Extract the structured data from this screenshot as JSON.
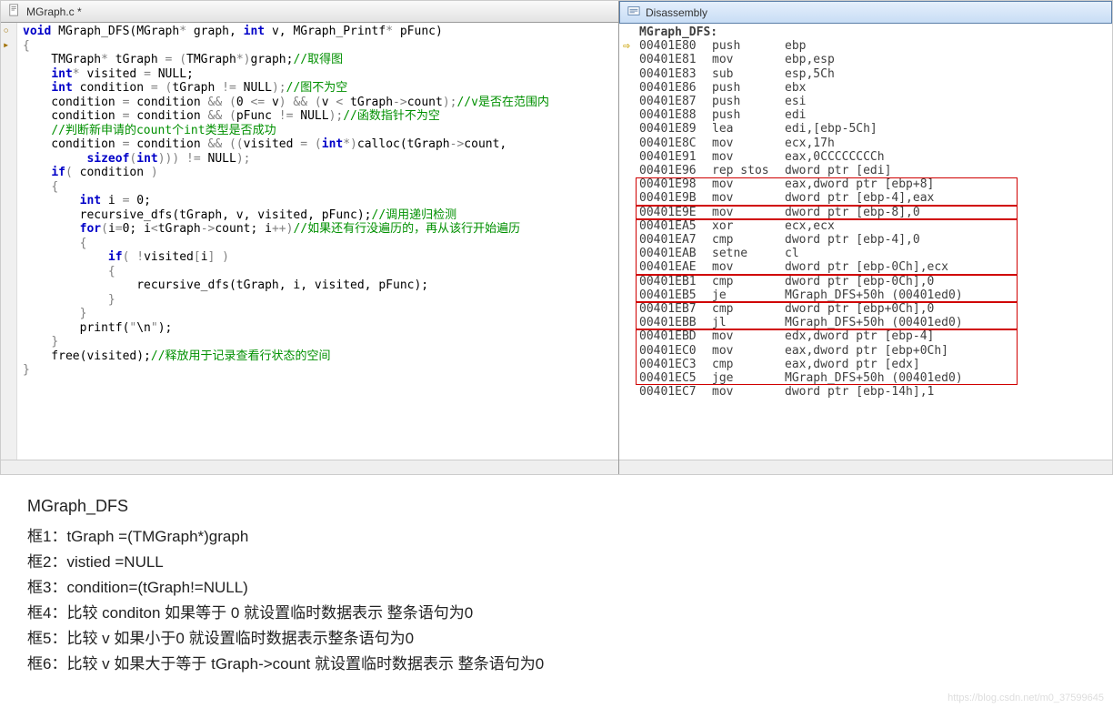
{
  "ide": {
    "code_tab": {
      "title": "MGraph.c *"
    },
    "disasm_tab": {
      "title": "Disassembly"
    },
    "code_lines": [
      [
        {
          "c": "kw",
          "t": "void"
        },
        {
          "c": "plain",
          "t": " MGraph_DFS(MGraph"
        },
        {
          "c": "sym",
          "t": "*"
        },
        {
          "c": "plain",
          "t": " graph, "
        },
        {
          "c": "kw",
          "t": "int"
        },
        {
          "c": "plain",
          "t": " v, MGraph_Printf"
        },
        {
          "c": "sym",
          "t": "*"
        },
        {
          "c": "plain",
          "t": " pFunc)"
        }
      ],
      [
        {
          "c": "sym",
          "t": "{"
        }
      ],
      [
        {
          "c": "plain",
          "t": "    TMGraph"
        },
        {
          "c": "sym",
          "t": "*"
        },
        {
          "c": "plain",
          "t": " tGraph "
        },
        {
          "c": "sym",
          "t": "= ("
        },
        {
          "c": "plain",
          "t": "TMGraph"
        },
        {
          "c": "sym",
          "t": "*)"
        },
        {
          "c": "plain",
          "t": "graph;"
        },
        {
          "c": "cm",
          "t": "//取得图"
        }
      ],
      [
        {
          "c": "plain",
          "t": "    "
        },
        {
          "c": "kw",
          "t": "int"
        },
        {
          "c": "sym",
          "t": "*"
        },
        {
          "c": "plain",
          "t": " visited "
        },
        {
          "c": "sym",
          "t": "="
        },
        {
          "c": "plain",
          "t": " NULL;"
        }
      ],
      [
        {
          "c": "plain",
          "t": "    "
        },
        {
          "c": "kw",
          "t": "int"
        },
        {
          "c": "plain",
          "t": " condition "
        },
        {
          "c": "sym",
          "t": "= ("
        },
        {
          "c": "plain",
          "t": "tGraph "
        },
        {
          "c": "sym",
          "t": "!="
        },
        {
          "c": "plain",
          "t": " NULL"
        },
        {
          "c": "sym",
          "t": ");"
        },
        {
          "c": "cm",
          "t": "//图不为空"
        }
      ],
      [
        {
          "c": "plain",
          "t": ""
        }
      ],
      [
        {
          "c": "plain",
          "t": "    condition "
        },
        {
          "c": "sym",
          "t": "="
        },
        {
          "c": "plain",
          "t": " condition "
        },
        {
          "c": "sym",
          "t": "&& ("
        },
        {
          "c": "plain",
          "t": "0 "
        },
        {
          "c": "sym",
          "t": "<="
        },
        {
          "c": "plain",
          "t": " v"
        },
        {
          "c": "sym",
          "t": ") && ("
        },
        {
          "c": "plain",
          "t": "v "
        },
        {
          "c": "sym",
          "t": "<"
        },
        {
          "c": "plain",
          "t": " tGraph"
        },
        {
          "c": "sym",
          "t": "->"
        },
        {
          "c": "plain",
          "t": "count"
        },
        {
          "c": "sym",
          "t": ");"
        },
        {
          "c": "cm",
          "t": "//v是否在范围内"
        }
      ],
      [
        {
          "c": "plain",
          "t": "    condition "
        },
        {
          "c": "sym",
          "t": "="
        },
        {
          "c": "plain",
          "t": " condition "
        },
        {
          "c": "sym",
          "t": "&& ("
        },
        {
          "c": "plain",
          "t": "pFunc "
        },
        {
          "c": "sym",
          "t": "!="
        },
        {
          "c": "plain",
          "t": " NULL"
        },
        {
          "c": "sym",
          "t": ");"
        },
        {
          "c": "cm",
          "t": "//函数指针不为空"
        }
      ],
      [
        {
          "c": "plain",
          "t": "    "
        },
        {
          "c": "cm",
          "t": "//判断新申请的count个int类型是否成功"
        }
      ],
      [
        {
          "c": "plain",
          "t": "    condition "
        },
        {
          "c": "sym",
          "t": "="
        },
        {
          "c": "plain",
          "t": " condition "
        },
        {
          "c": "sym",
          "t": "&& (("
        },
        {
          "c": "plain",
          "t": "visited "
        },
        {
          "c": "sym",
          "t": "= ("
        },
        {
          "c": "kw",
          "t": "int"
        },
        {
          "c": "sym",
          "t": "*)"
        },
        {
          "c": "plain",
          "t": "calloc(tGraph"
        },
        {
          "c": "sym",
          "t": "->"
        },
        {
          "c": "plain",
          "t": "count,"
        }
      ],
      [
        {
          "c": "plain",
          "t": "         "
        },
        {
          "c": "kw",
          "t": "sizeof"
        },
        {
          "c": "sym",
          "t": "("
        },
        {
          "c": "kw",
          "t": "int"
        },
        {
          "c": "sym",
          "t": "))) !="
        },
        {
          "c": "plain",
          "t": " NULL"
        },
        {
          "c": "sym",
          "t": ");"
        }
      ],
      [
        {
          "c": "plain",
          "t": "    "
        },
        {
          "c": "kw",
          "t": "if"
        },
        {
          "c": "sym",
          "t": "("
        },
        {
          "c": "plain",
          "t": " condition "
        },
        {
          "c": "sym",
          "t": ")"
        }
      ],
      [
        {
          "c": "plain",
          "t": "    "
        },
        {
          "c": "sym",
          "t": "{"
        }
      ],
      [
        {
          "c": "plain",
          "t": "        "
        },
        {
          "c": "kw",
          "t": "int"
        },
        {
          "c": "plain",
          "t": " i "
        },
        {
          "c": "sym",
          "t": "="
        },
        {
          "c": "plain",
          "t": " 0;"
        }
      ],
      [
        {
          "c": "plain",
          "t": "        recursive_dfs(tGraph, v, visited, pFunc);"
        },
        {
          "c": "cm",
          "t": "//调用递归检测"
        }
      ],
      [
        {
          "c": "plain",
          "t": ""
        }
      ],
      [
        {
          "c": "plain",
          "t": "        "
        },
        {
          "c": "kw",
          "t": "for"
        },
        {
          "c": "sym",
          "t": "("
        },
        {
          "c": "plain",
          "t": "i"
        },
        {
          "c": "sym",
          "t": "="
        },
        {
          "c": "plain",
          "t": "0; i"
        },
        {
          "c": "sym",
          "t": "<"
        },
        {
          "c": "plain",
          "t": "tGraph"
        },
        {
          "c": "sym",
          "t": "->"
        },
        {
          "c": "plain",
          "t": "count; i"
        },
        {
          "c": "sym",
          "t": "++)"
        },
        {
          "c": "cm",
          "t": "//如果还有行没遍历的，再从该行开始遍历"
        }
      ],
      [
        {
          "c": "plain",
          "t": "        "
        },
        {
          "c": "sym",
          "t": "{"
        }
      ],
      [
        {
          "c": "plain",
          "t": "            "
        },
        {
          "c": "kw",
          "t": "if"
        },
        {
          "c": "sym",
          "t": "( !"
        },
        {
          "c": "plain",
          "t": "visited"
        },
        {
          "c": "sym",
          "t": "["
        },
        {
          "c": "plain",
          "t": "i"
        },
        {
          "c": "sym",
          "t": "] )"
        }
      ],
      [
        {
          "c": "plain",
          "t": "            "
        },
        {
          "c": "sym",
          "t": "{"
        }
      ],
      [
        {
          "c": "plain",
          "t": ""
        }
      ],
      [
        {
          "c": "plain",
          "t": "                recursive_dfs(tGraph, i, visited, pFunc);"
        }
      ],
      [
        {
          "c": "plain",
          "t": "            "
        },
        {
          "c": "sym",
          "t": "}"
        }
      ],
      [
        {
          "c": "plain",
          "t": "        "
        },
        {
          "c": "sym",
          "t": "}"
        }
      ],
      [
        {
          "c": "plain",
          "t": "        printf("
        },
        {
          "c": "sym",
          "t": "\""
        },
        {
          "c": "plain",
          "t": "\\n"
        },
        {
          "c": "sym",
          "t": "\""
        },
        {
          "c": "plain",
          "t": ");"
        }
      ],
      [
        {
          "c": "plain",
          "t": "    "
        },
        {
          "c": "sym",
          "t": "}"
        }
      ],
      [
        {
          "c": "plain",
          "t": "    free(visited);"
        },
        {
          "c": "cm",
          "t": "//释放用于记录查看行状态的空间"
        }
      ],
      [
        {
          "c": "sym",
          "t": "}"
        }
      ]
    ],
    "disasm": {
      "label": "MGraph_DFS:",
      "arrow_index": 0,
      "lines": [
        {
          "addr": "00401E80",
          "mn": "push",
          "op": "ebp"
        },
        {
          "addr": "00401E81",
          "mn": "mov",
          "op": "ebp,esp"
        },
        {
          "addr": "00401E83",
          "mn": "sub",
          "op": "esp,5Ch"
        },
        {
          "addr": "00401E86",
          "mn": "push",
          "op": "ebx"
        },
        {
          "addr": "00401E87",
          "mn": "push",
          "op": "esi"
        },
        {
          "addr": "00401E88",
          "mn": "push",
          "op": "edi"
        },
        {
          "addr": "00401E89",
          "mn": "lea",
          "op": "edi,[ebp-5Ch]"
        },
        {
          "addr": "00401E8C",
          "mn": "mov",
          "op": "ecx,17h"
        },
        {
          "addr": "00401E91",
          "mn": "mov",
          "op": "eax,0CCCCCCCCh"
        },
        {
          "addr": "00401E96",
          "mn": "rep stos",
          "op": "dword ptr [edi]"
        },
        {
          "addr": "00401E98",
          "mn": "mov",
          "op": "eax,dword ptr [ebp+8]"
        },
        {
          "addr": "00401E9B",
          "mn": "mov",
          "op": "dword ptr [ebp-4],eax"
        },
        {
          "addr": "00401E9E",
          "mn": "mov",
          "op": "dword ptr [ebp-8],0"
        },
        {
          "addr": "00401EA5",
          "mn": "xor",
          "op": "ecx,ecx"
        },
        {
          "addr": "00401EA7",
          "mn": "cmp",
          "op": "dword ptr [ebp-4],0"
        },
        {
          "addr": "00401EAB",
          "mn": "setne",
          "op": "cl"
        },
        {
          "addr": "00401EAE",
          "mn": "mov",
          "op": "dword ptr [ebp-0Ch],ecx"
        },
        {
          "addr": "00401EB1",
          "mn": "cmp",
          "op": "dword ptr [ebp-0Ch],0"
        },
        {
          "addr": "00401EB5",
          "mn": "je",
          "op": "MGraph_DFS+50h (00401ed0)"
        },
        {
          "addr": "00401EB7",
          "mn": "cmp",
          "op": "dword ptr [ebp+0Ch],0"
        },
        {
          "addr": "00401EBB",
          "mn": "jl",
          "op": "MGraph_DFS+50h (00401ed0)"
        },
        {
          "addr": "00401EBD",
          "mn": "mov",
          "op": "edx,dword ptr [ebp-4]"
        },
        {
          "addr": "00401EC0",
          "mn": "mov",
          "op": "eax,dword ptr [ebp+0Ch]"
        },
        {
          "addr": "00401EC3",
          "mn": "cmp",
          "op": "eax,dword ptr [edx]"
        },
        {
          "addr": "00401EC5",
          "mn": "jge",
          "op": "MGraph_DFS+50h (00401ed0)"
        },
        {
          "addr": "00401EC7",
          "mn": "mov",
          "op": "dword ptr [ebp-14h],1"
        }
      ],
      "boxes": [
        {
          "start": 10,
          "end": 11
        },
        {
          "start": 12,
          "end": 12
        },
        {
          "start": 13,
          "end": 16
        },
        {
          "start": 17,
          "end": 18
        },
        {
          "start": 19,
          "end": 20
        },
        {
          "start": 21,
          "end": 24
        }
      ]
    }
  },
  "notes": {
    "title": "MGraph_DFS",
    "lines": [
      "框1：tGraph =(TMGraph*)graph",
      "框2：vistied =NULL",
      "框3：condition=(tGraph!=NULL)",
      "框4：比较 conditon 如果等于 0 就设置临时数据表示 整条语句为0",
      "框5：比较 v 如果小于0 就设置临时数据表示整条语句为0",
      "框6：比较 v 如果大于等于 tGraph->count  就设置临时数据表示 整条语句为0"
    ]
  },
  "watermark": "https://blog.csdn.net/m0_37599645"
}
